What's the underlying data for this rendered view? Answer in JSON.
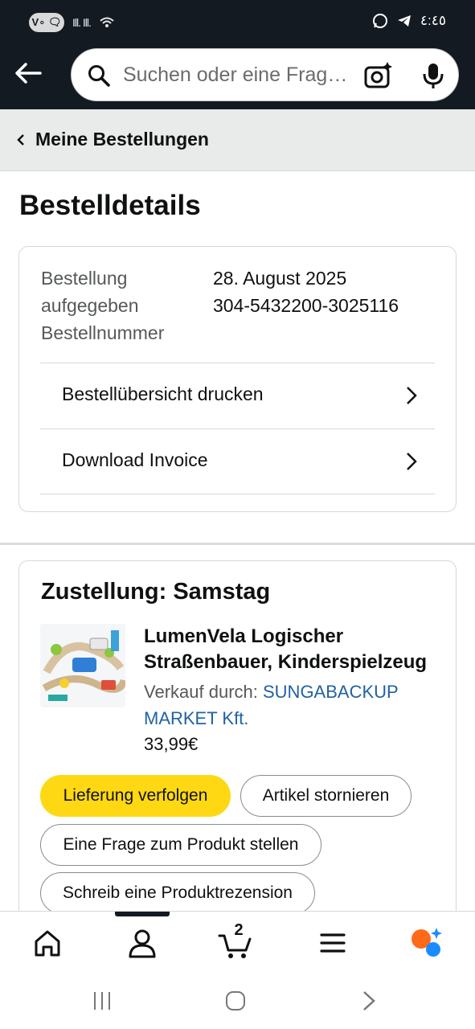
{
  "status_bar": {
    "network_badge": "V∘ 🗨",
    "signal": "Ill. Ill.",
    "time": "٤:٤٥",
    "icons": [
      "whatsapp-icon",
      "telegram-icon",
      "wifi-icon"
    ]
  },
  "header": {
    "search_placeholder": "Suchen oder eine Frage stellen",
    "icons": [
      "back-arrow-icon",
      "search-icon",
      "camera-icon",
      "microphone-icon"
    ]
  },
  "breadcrumb": {
    "label": "Meine Bestellungen"
  },
  "page_title": "Bestelldetails",
  "order": {
    "labels": [
      "Bestellung",
      "aufgegeben",
      "Bestellnummer"
    ],
    "date": "28. August 2025",
    "number": "304-5432200-3025116",
    "links": {
      "print": "Bestellübersicht drucken",
      "invoice": "Download Invoice"
    }
  },
  "delivery": {
    "title": "Zustellung: Samstag",
    "product": {
      "title_line1": "LumenVela Logischer",
      "title_line2": "Straßenbauer, Kinderspielzeug",
      "seller_prefix": "Verkauf durch:",
      "seller_name_line1": "SUNGABACKUP",
      "seller_name_line2": "MARKET Kft.",
      "price": "33,99€"
    },
    "buttons": {
      "track": "Lieferung verfolgen",
      "cancel": "Artikel stornieren",
      "question": "Eine Frage zum Produkt stellen",
      "review": "Schreib eine Produktrezension"
    }
  },
  "bottom_nav": {
    "cart_count": "2",
    "items": [
      "home-icon",
      "account-icon",
      "cart-icon",
      "menu-icon",
      "rufus-icon"
    ]
  },
  "colors": {
    "header_bg": "#131a22",
    "accent_yellow": "#ffd814",
    "link_blue": "#2162a1",
    "rufus_orange": "#ff6a1a",
    "rufus_blue": "#1a8cff"
  }
}
